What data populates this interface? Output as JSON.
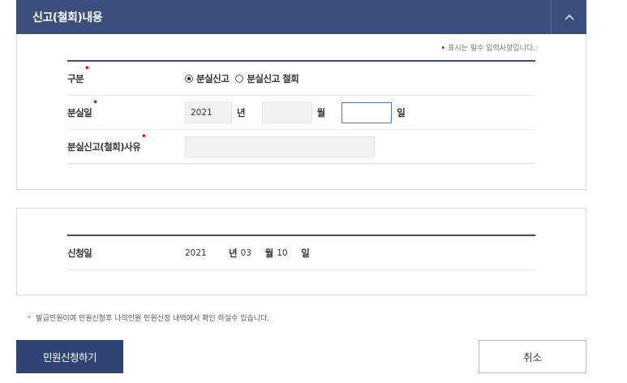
{
  "panel": {
    "title": "신고(철회)내용",
    "collapse_icon": "chevron-up-icon"
  },
  "required_note": {
    "mark": "•",
    "text": "표시는 필수 입력사항입니다."
  },
  "form": {
    "type_row": {
      "label": "구분",
      "options": [
        {
          "label": "분실신고",
          "selected": true
        },
        {
          "label": "분실신고 철회",
          "selected": false
        }
      ]
    },
    "date_row": {
      "label": "분실일",
      "year_value": "2021",
      "year_unit": "년",
      "month_value": "",
      "month_unit": "월",
      "day_value": "",
      "day_unit": "일"
    },
    "reason_row": {
      "label": "분실신고(철회)사유",
      "value": ""
    }
  },
  "apply": {
    "label": "신청일",
    "year": "2021",
    "year_unit": "년",
    "month": "03",
    "month_unit": "월",
    "day": "10",
    "day_unit": "일"
  },
  "footnote": {
    "mark": "*",
    "text": "발급민원이며 민원신청후 나의민원 민원신청 내역에서 확인 하실수 있습니다."
  },
  "buttons": {
    "submit": "민원신청하기",
    "cancel": "취소"
  },
  "colors": {
    "header": "#3b4f7e",
    "submit": "#2f4374",
    "required": "#e0001b",
    "focus": "#4a7bd0"
  }
}
